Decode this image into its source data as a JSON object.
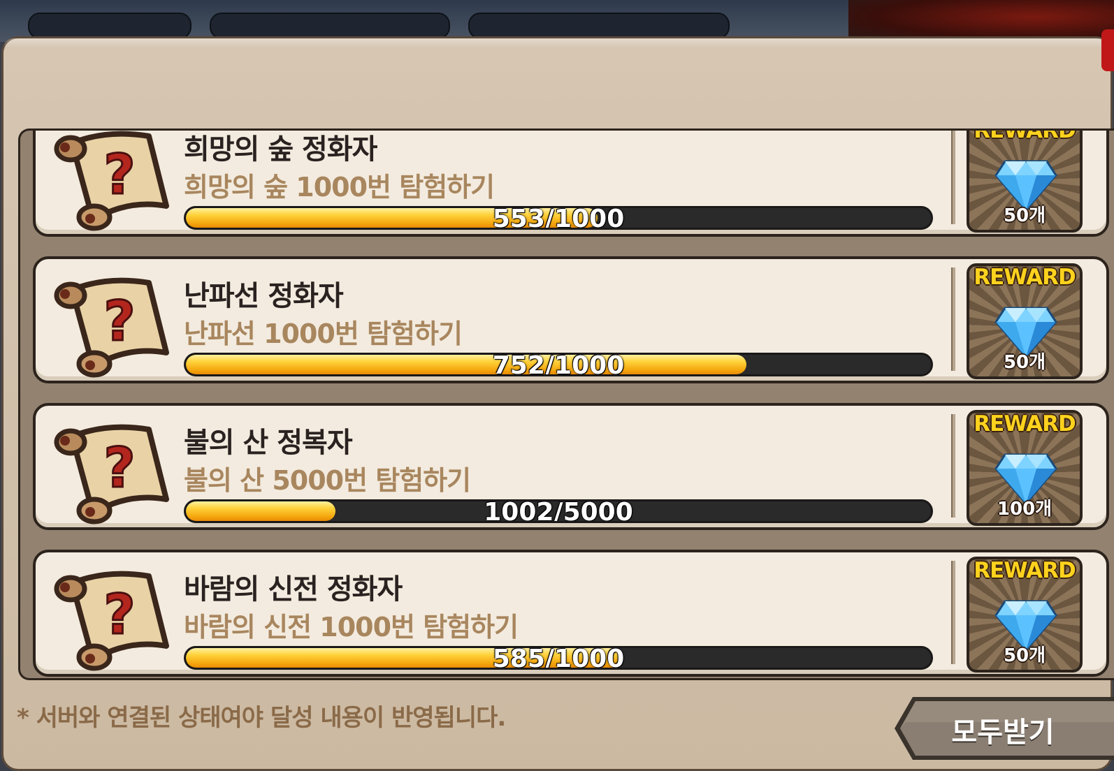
{
  "footer": {
    "note": "* 서버와 연결된 상태여야 달성 내용이 반영됩니다.",
    "claim_all_label": "모두받기"
  },
  "achievements": [
    {
      "title": "희망의 숲 정화자",
      "description": "희망의 숲 1000번 탐험하기",
      "progress_text": "553/1000",
      "current": 553,
      "total": 1000,
      "reward_label": "REWARD",
      "reward_qty": "50개",
      "reward_icon": "diamond-icon"
    },
    {
      "title": "난파선 정화자",
      "description": "난파선 1000번 탐험하기",
      "progress_text": "752/1000",
      "current": 752,
      "total": 1000,
      "reward_label": "REWARD",
      "reward_qty": "50개",
      "reward_icon": "diamond-icon"
    },
    {
      "title": "불의 산 정복자",
      "description": "불의 산 5000번 탐험하기",
      "progress_text": "1002/5000",
      "current": 1002,
      "total": 5000,
      "reward_label": "REWARD",
      "reward_qty": "100개",
      "reward_icon": "diamond-icon"
    },
    {
      "title": "바람의 신전 정화자",
      "description": "바람의 신전 1000번 탐험하기",
      "progress_text": "585/1000",
      "current": 585,
      "total": 1000,
      "reward_label": "REWARD",
      "reward_qty": "50개",
      "reward_icon": "diamond-icon"
    }
  ],
  "colors": {
    "progress_fill": "#f4a40c",
    "reward_label": "#ffd21e",
    "description": "#a8865e"
  }
}
